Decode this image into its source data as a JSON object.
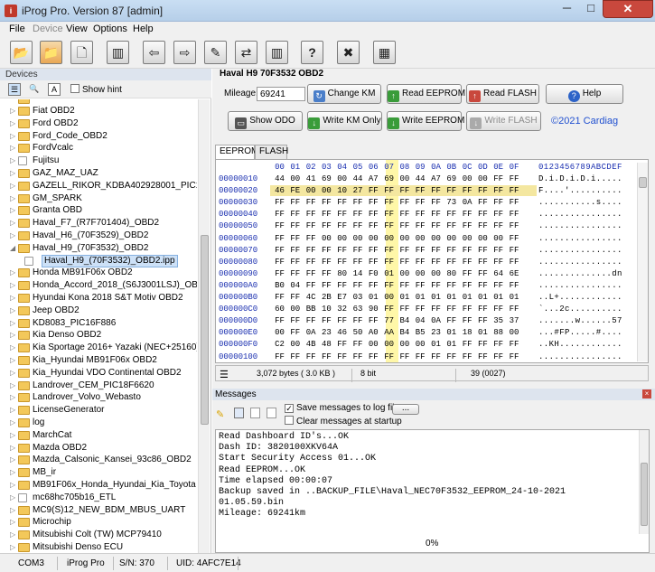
{
  "window": {
    "title": "iProg Pro. Version 87 [admin]",
    "app_icon": "i",
    "minimize": "─",
    "maximize": "□",
    "close": "✕"
  },
  "menu": [
    "File",
    "Device",
    "View",
    "Options",
    "Help"
  ],
  "toolbar": {
    "icons": [
      "folder-open-icon",
      "folder-save-icon",
      "new-file-icon",
      "chip-icon",
      "arrow-left-icon",
      "arrow-right-icon",
      "write-icon",
      "swap-icon",
      "help-icon",
      "close-icon",
      "calculator-icon"
    ],
    "glyphs": [
      "📂",
      "📁",
      "🗋",
      "▥",
      "⇦",
      "⇨",
      "✎",
      "⇄",
      "?",
      "✖",
      "▦"
    ]
  },
  "devices": {
    "header": "Devices",
    "show_hint": "Show hint",
    "items": [
      {
        "label": "Fiat OBD2",
        "type": "folder"
      },
      {
        "label": "Ford OBD2",
        "type": "folder"
      },
      {
        "label": "Ford_Code_OBD2",
        "type": "folder"
      },
      {
        "label": "FordVcalc",
        "type": "folder"
      },
      {
        "label": "Fujitsu",
        "type": "file"
      },
      {
        "label": "GAZ_MAZ_UAZ",
        "type": "folder"
      },
      {
        "label": "GAZELL_RIKOR_KDBA402928001_PIC16F884",
        "type": "folder"
      },
      {
        "label": "GM_SPARK",
        "type": "folder"
      },
      {
        "label": "Granta OBD",
        "type": "folder"
      },
      {
        "label": "Haval_F7_(R7F701404)_OBD2",
        "type": "folder"
      },
      {
        "label": "Haval_H6_(70F3529)_OBD2",
        "type": "folder"
      },
      {
        "label": "Haval_H9_(70F3532)_OBD2",
        "type": "folder",
        "expanded": true
      },
      {
        "label": "Haval_H9_(70F3532)_OBD2.ipp",
        "type": "file",
        "child": true,
        "selected": true
      },
      {
        "label": "Honda MB91F06x OBD2",
        "type": "folder"
      },
      {
        "label": "Honda_Accord_2018_(S6J3001LSJ)_OBD2",
        "type": "folder"
      },
      {
        "label": "Hyundai Kona 2018 S&T Motiv OBD2",
        "type": "folder"
      },
      {
        "label": "Jeep OBD2",
        "type": "folder"
      },
      {
        "label": "KD8083_PIC16F886",
        "type": "folder"
      },
      {
        "label": "Kia Denso OBD2",
        "type": "folder"
      },
      {
        "label": "Kia Sportage 2016+ Yazaki (NEC+25160)",
        "type": "folder"
      },
      {
        "label": "Kia_Hyundai MB91F06x OBD2",
        "type": "folder"
      },
      {
        "label": "Kia_Hyundai VDO Continental OBD2",
        "type": "folder"
      },
      {
        "label": "Landrover_CEM_PIC18F6620",
        "type": "folder"
      },
      {
        "label": "Landrover_Volvo_Webasto",
        "type": "folder"
      },
      {
        "label": "LicenseGenerator",
        "type": "folder"
      },
      {
        "label": "log",
        "type": "folder"
      },
      {
        "label": "MarchCat",
        "type": "folder"
      },
      {
        "label": "Mazda OBD2",
        "type": "folder"
      },
      {
        "label": "Mazda_Calsonic_Kansei_93c86_OBD2",
        "type": "folder"
      },
      {
        "label": "MB_ir",
        "type": "folder"
      },
      {
        "label": "MB91F06x_Honda_Hyundai_Kia_Toyota",
        "type": "folder"
      },
      {
        "label": "mc68hc705b16_ETL",
        "type": "file"
      },
      {
        "label": "MC9(S)12_NEW_BDM_MBUS_UART",
        "type": "folder"
      },
      {
        "label": "Microchip",
        "type": "folder"
      },
      {
        "label": "Mitsubishi Colt (TW) MCP79410",
        "type": "folder"
      },
      {
        "label": "Mitsubishi Denso ECU",
        "type": "folder"
      }
    ]
  },
  "device_panel": {
    "title": "Haval H9 70F3532 OBD2",
    "mileage_label": "Mileage:",
    "mileage_value": "69241",
    "buttons": {
      "change_km": "Change KM",
      "read_eeprom": "Read EEPROM",
      "read_flash": "Read FLASH",
      "help": "Help",
      "show_odo": "Show ODO",
      "write_km_only": "Write KM Only",
      "write_eeprom": "Write EEPROM",
      "write_flash": "Write FLASH"
    },
    "copyright": "©2021 Cardiag"
  },
  "tabs": [
    "EEPROM",
    "FLASH"
  ],
  "hex": {
    "header_cols": [
      "00",
      "01",
      "02",
      "03",
      "04",
      "05",
      "06",
      "07",
      "08",
      "09",
      "0A",
      "0B",
      "0C",
      "0D",
      "0E",
      "0F"
    ],
    "ascii_header": "0123456789ABCDEF",
    "rows": [
      {
        "addr": "00000010",
        "bytes": [
          "44",
          "00",
          "41",
          "69",
          "00",
          "44",
          "A7",
          "69",
          "00",
          "44",
          "A7",
          "69",
          "00",
          "00",
          "FF",
          "FF"
        ],
        "ascii": "D.i.D.i.D.i....."
      },
      {
        "addr": "00000020",
        "bytes": [
          "46",
          "FE",
          "00",
          "00",
          "10",
          "27",
          "FF",
          "FF",
          "FF",
          "FF",
          "FF",
          "FF",
          "FF",
          "FF",
          "FF",
          "FF"
        ],
        "ascii": "F....'.........."
      },
      {
        "addr": "00000030",
        "bytes": [
          "FF",
          "FF",
          "FF",
          "FF",
          "FF",
          "FF",
          "FF",
          "FF",
          "FF",
          "FF",
          "FF",
          "73",
          "0A",
          "FF",
          "FF",
          "FF"
        ],
        "ascii": "...........s...."
      },
      {
        "addr": "00000040",
        "bytes": [
          "FF",
          "FF",
          "FF",
          "FF",
          "FF",
          "FF",
          "FF",
          "FF",
          "FF",
          "FF",
          "FF",
          "FF",
          "FF",
          "FF",
          "FF",
          "FF"
        ],
        "ascii": "................"
      },
      {
        "addr": "00000050",
        "bytes": [
          "FF",
          "FF",
          "FF",
          "FF",
          "FF",
          "FF",
          "FF",
          "FF",
          "FF",
          "FF",
          "FF",
          "FF",
          "FF",
          "FF",
          "FF",
          "FF"
        ],
        "ascii": "................"
      },
      {
        "addr": "00000060",
        "bytes": [
          "FF",
          "FF",
          "FF",
          "00",
          "00",
          "00",
          "00",
          "00",
          "00",
          "00",
          "00",
          "00",
          "00",
          "00",
          "00",
          "FF"
        ],
        "ascii": "................"
      },
      {
        "addr": "00000070",
        "bytes": [
          "FF",
          "FF",
          "FF",
          "FF",
          "FF",
          "FF",
          "FF",
          "FF",
          "FF",
          "FF",
          "FF",
          "FF",
          "FF",
          "FF",
          "FF",
          "FF"
        ],
        "ascii": "................"
      },
      {
        "addr": "00000080",
        "bytes": [
          "FF",
          "FF",
          "FF",
          "FF",
          "FF",
          "FF",
          "FF",
          "FF",
          "FF",
          "FF",
          "FF",
          "FF",
          "FF",
          "FF",
          "FF",
          "FF"
        ],
        "ascii": "................"
      },
      {
        "addr": "00000090",
        "bytes": [
          "FF",
          "FF",
          "FF",
          "FF",
          "80",
          "14",
          "F0",
          "01",
          "00",
          "00",
          "00",
          "80",
          "FF",
          "FF",
          "64",
          "6E"
        ],
        "ascii": "..............dn"
      },
      {
        "addr": "000000A0",
        "bytes": [
          "B0",
          "04",
          "FF",
          "FF",
          "FF",
          "FF",
          "FF",
          "FF",
          "FF",
          "FF",
          "FF",
          "FF",
          "FF",
          "FF",
          "FF",
          "FF"
        ],
        "ascii": "................"
      },
      {
        "addr": "000000B0",
        "bytes": [
          "FF",
          "FF",
          "4C",
          "2B",
          "E7",
          "03",
          "01",
          "00",
          "01",
          "01",
          "01",
          "01",
          "01",
          "01",
          "01",
          "01"
        ],
        "ascii": "..L+............"
      },
      {
        "addr": "000000C0",
        "bytes": [
          "60",
          "00",
          "BB",
          "10",
          "32",
          "63",
          "90",
          "FF",
          "FF",
          "FF",
          "FF",
          "FF",
          "FF",
          "FF",
          "FF",
          "FF"
        ],
        "ascii": "`...2c.........."
      },
      {
        "addr": "000000D0",
        "bytes": [
          "FF",
          "FF",
          "FF",
          "FF",
          "FF",
          "FF",
          "FF",
          "77",
          "B4",
          "04",
          "0A",
          "FF",
          "FF",
          "FF",
          "35",
          "37"
        ],
        "ascii": ".......w......57"
      },
      {
        "addr": "000000E0",
        "bytes": [
          "00",
          "FF",
          "0A",
          "23",
          "46",
          "50",
          "A0",
          "AA",
          "B4",
          "B5",
          "23",
          "01",
          "18",
          "01",
          "88",
          "00"
        ],
        "ascii": "...#FP.....#...."
      },
      {
        "addr": "000000F0",
        "bytes": [
          "C2",
          "00",
          "4B",
          "48",
          "FF",
          "FF",
          "00",
          "00",
          "00",
          "00",
          "01",
          "01",
          "FF",
          "FF",
          "FF",
          "FF"
        ],
        "ascii": "..KH............"
      },
      {
        "addr": "00000100",
        "bytes": [
          "FF",
          "FF",
          "FF",
          "FF",
          "FF",
          "FF",
          "FF",
          "FF",
          "FF",
          "FF",
          "FF",
          "FF",
          "FF",
          "FF",
          "FF",
          "FF"
        ],
        "ascii": "................"
      }
    ]
  },
  "hex_status": {
    "size": "3,072 bytes ( 3.0 KB )",
    "bits": "8 bit",
    "position": "39 (0027)"
  },
  "messages": {
    "header": "Messages",
    "save_log": "Save messages to log file",
    "clear_startup": "Clear messages at startup",
    "browse": "...",
    "lines": [
      "Read Dashboard ID's...OK",
      "Dash ID: 3820100XKV64A",
      "Start Security Access 01...OK",
      "Read EEPROM...OK",
      "Time elapsed 00:00:07",
      "Backup saved in ..BACKUP_FILE\\Haval_NEC70F3532_EEPROM_24-10-2021",
      "01.05.59.bin",
      "Mileage: 69241km"
    ],
    "progress": "0%"
  },
  "status": {
    "port": "COM3",
    "app": "iProg Pro",
    "serial": "S/N: 370",
    "uid": "UID: 4AFC7E14"
  }
}
